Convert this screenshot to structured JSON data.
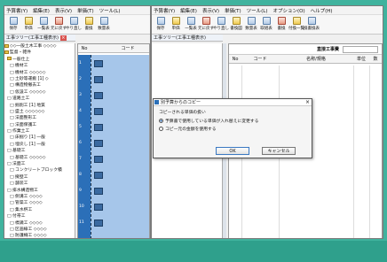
{
  "menu": [
    "予算書(Y)",
    "編集(E)",
    "表示(V)",
    "単価(T)",
    "ツール(L)",
    "オプション(O)",
    "ヘルプ(H)"
  ],
  "toolbar_left": [
    "保存",
    "単価",
    "一覧表",
    "元に戻す",
    "やり直し",
    "書換",
    "数量表"
  ],
  "toolbar_right": [
    "保存",
    "単価",
    "一覧表",
    "元に戻す",
    "やり直し",
    "書換図",
    "数量表",
    "取組表",
    "書換",
    "付換一覧",
    "換書換表"
  ],
  "tree": {
    "header": "工事ツリー(工事工種表示)",
    "header2": "工事ツリー(工事工種表示)",
    "items": [
      "◇◇一般土木工事 ◇◇◇◇",
      "監督・雑件",
      "一般仕上",
      "□ 機材工",
      "□ 機材工 ◇◇◇◇◇",
      "□ 土砂等運搬 [1] ◇",
      "□ 構造物撤去工",
      "□ 仮設工 ◇◇◇◇◇",
      "□ 道路土工",
      "□ 掘削工 [1] 地質",
      "□ 盛土 ◇◇◇◇◇◇",
      "□ 法面整形工",
      "□ 法面保護工",
      "□ 作業土工",
      "□ 床掘り [1] 一般",
      "□ 埋戻し [1] 一般",
      "□ 基礎工",
      "□ 基礎工 ◇◇◇◇◇",
      "□ 法面工",
      "□ コンクリートブロック積",
      "□ 擁壁工",
      "□ 舗装工",
      "□ 排水構造物工",
      "□ 側溝工 ◇◇◇◇",
      "□ 管渠工 ◇◇◇◇",
      "□ 集水桝工",
      "□ 付帯工",
      "□ 標識工 ◇◇◇◇",
      "□ 区画線工 ◇◇◇◇",
      "□ 防護柵工 ◇◇◇◇",
      "□ 構造物撤去工",
      "□ 仮設工"
    ]
  },
  "grid_left": {
    "col_no": "No",
    "col_code": "コード",
    "rows": [
      "1",
      "2",
      "3",
      "4",
      "5",
      "6",
      "7",
      "8",
      "9",
      "10",
      "11",
      "12"
    ]
  },
  "grid_right": {
    "col_no": "No",
    "col_code": "コード",
    "col_name": "名称/規格",
    "col_unit": "単位",
    "col_qty": "数",
    "title": "直接工事費"
  },
  "dialog": {
    "title": "別予算からのコピー",
    "prompt": "コピーされる単価の扱い",
    "opt1": "予算書で使用している単価が入れ替えに変更する",
    "opt2": "コピー元の金額を使用する",
    "ok": "OK",
    "cancel": "キャンセル"
  }
}
